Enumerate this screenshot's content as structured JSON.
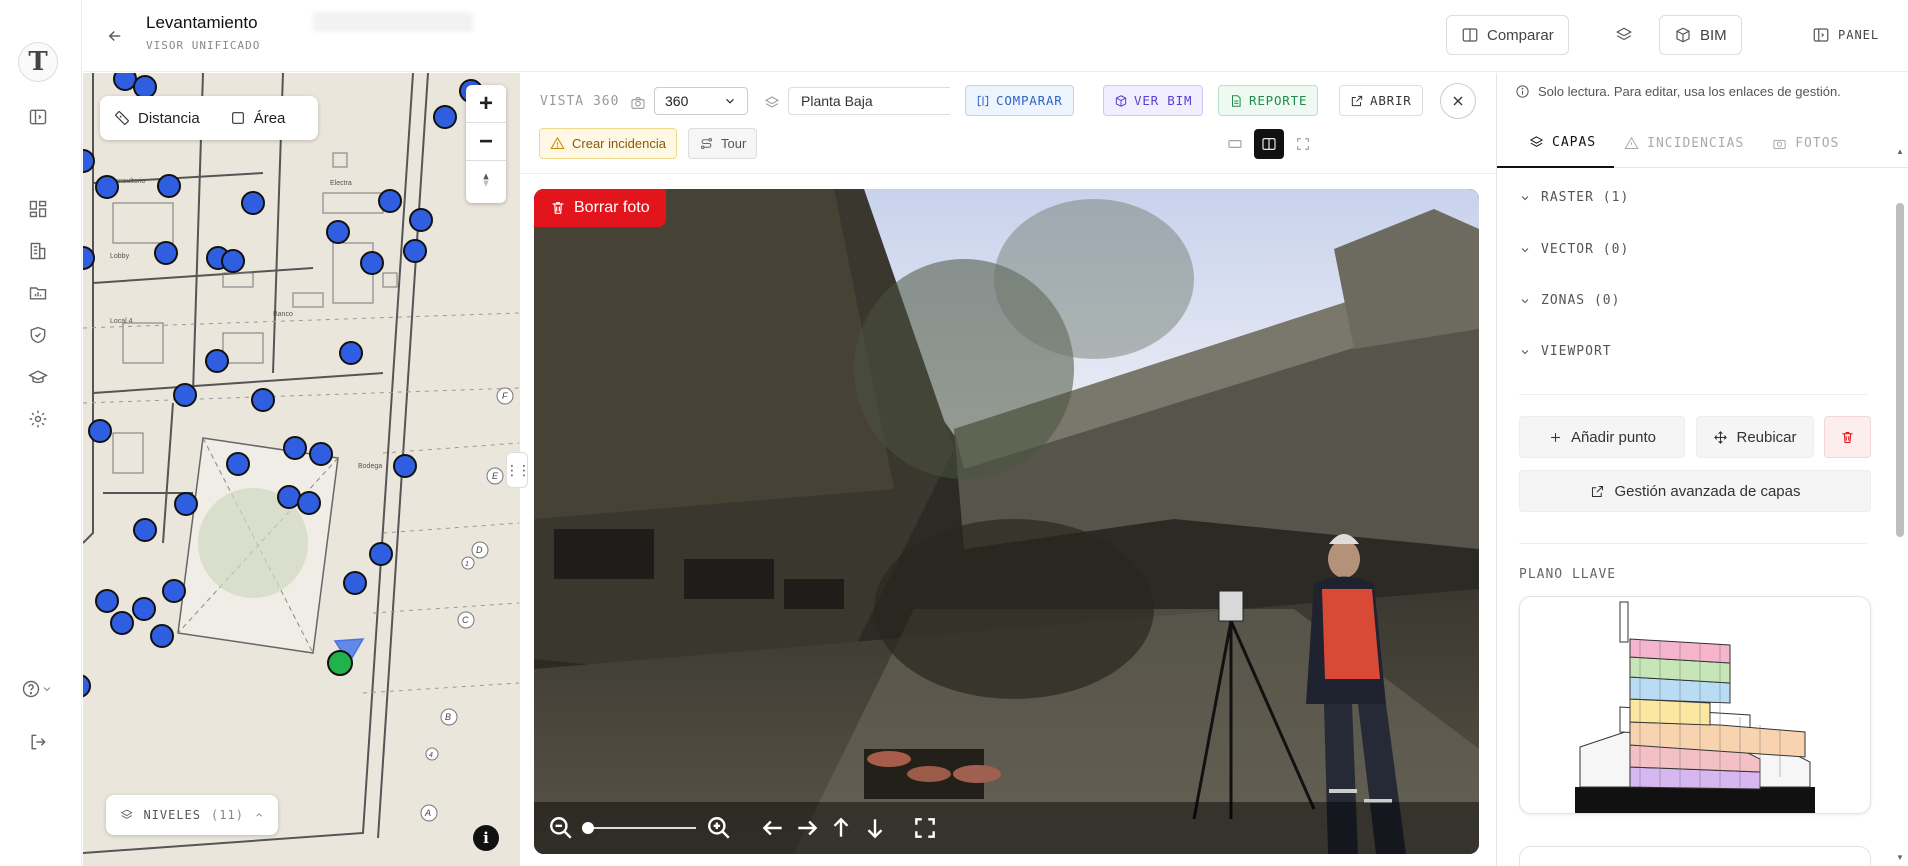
{
  "header": {
    "title": "Levantamiento",
    "subtitle": "VISOR UNIFICADO",
    "compare_label": "Comparar",
    "bim_label": "BIM",
    "panel_label": "PANEL"
  },
  "rail": {
    "logo_letter": "T",
    "icons": [
      "panel-toggle-icon",
      "dashboard-icon",
      "building-icon",
      "folder-chart-icon",
      "shield-check-icon",
      "graduation-cap-icon",
      "settings-icon",
      "help-icon",
      "logout-icon"
    ]
  },
  "map": {
    "distance_label": "Distancia",
    "area_label": "Área",
    "zoom_in": "+",
    "zoom_out": "−",
    "levels_label": "NIVELES",
    "levels_count": "(11)",
    "info_label": "i",
    "room_labels": [
      "Consultorio",
      "Lobby",
      "Local 4",
      "Banco",
      "Electra",
      "Bodega"
    ],
    "grid_labels": [
      "F",
      "E",
      "D",
      "C",
      "B",
      "A",
      "1",
      "4"
    ],
    "point_color": "#2f5fe0",
    "current_point_color": "#22b24c"
  },
  "viewer": {
    "mode_label": "VISTA 360",
    "mode_value": "360",
    "floor_value": "Planta Baja",
    "compare_label": "COMPARAR",
    "bim_label": "VER BIM",
    "report_label": "REPORTE",
    "open_label": "ABRIR",
    "incident_label": "Crear incidencia",
    "tour_label": "Tour",
    "delete_photo_label": "Borrar foto",
    "zoom_fraction": 0.0
  },
  "right_panel": {
    "readonly_notice": "Solo lectura. Para editar, usa los enlaces de gestión.",
    "tabs": [
      {
        "label": "CAPAS",
        "active": true
      },
      {
        "label": "INCIDENCIAS",
        "active": false
      },
      {
        "label": "FOTOS",
        "active": false
      }
    ],
    "sections": [
      "RASTER (1)",
      "VECTOR (0)",
      "ZONAS (0)",
      "VIEWPORT"
    ],
    "add_point_label": "Añadir punto",
    "relocate_label": "Reubicar",
    "advanced_label": "Gestión avanzada de capas",
    "key_plan_label": "PLANO LLAVE"
  },
  "colors": {
    "accent_red": "#e2141c",
    "compare_blue": "#2c63c8",
    "bim_purple": "#5a3fd0",
    "report_green": "#1f8a4a"
  }
}
